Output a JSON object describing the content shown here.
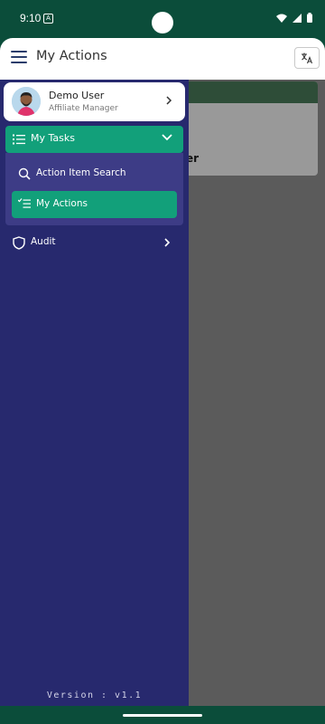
{
  "status_bar": {
    "time": "9:10",
    "notification_badge": "A"
  },
  "app_bar": {
    "title": "My Actions",
    "menu_icon": "hamburger-icon",
    "translate_icon": "translate-icon"
  },
  "background_card": {
    "text": "er"
  },
  "drawer": {
    "user": {
      "name": "Demo User",
      "role": "Affiliate Manager"
    },
    "tasks": {
      "label": "My Tasks",
      "expanded": true,
      "items": [
        {
          "label": "Action Item Search",
          "icon": "search-icon"
        },
        {
          "label": "My Actions",
          "icon": "list-check-icon",
          "active": true
        }
      ]
    },
    "audit": {
      "label": "Audit",
      "icon": "shield-icon"
    },
    "version": "Version : v1.1"
  },
  "colors": {
    "drawer_bg": "#27296e",
    "accent_green": "#12a07a",
    "submenu_bg": "#3d3c86",
    "status_bar_bg": "#0b4d3a"
  }
}
